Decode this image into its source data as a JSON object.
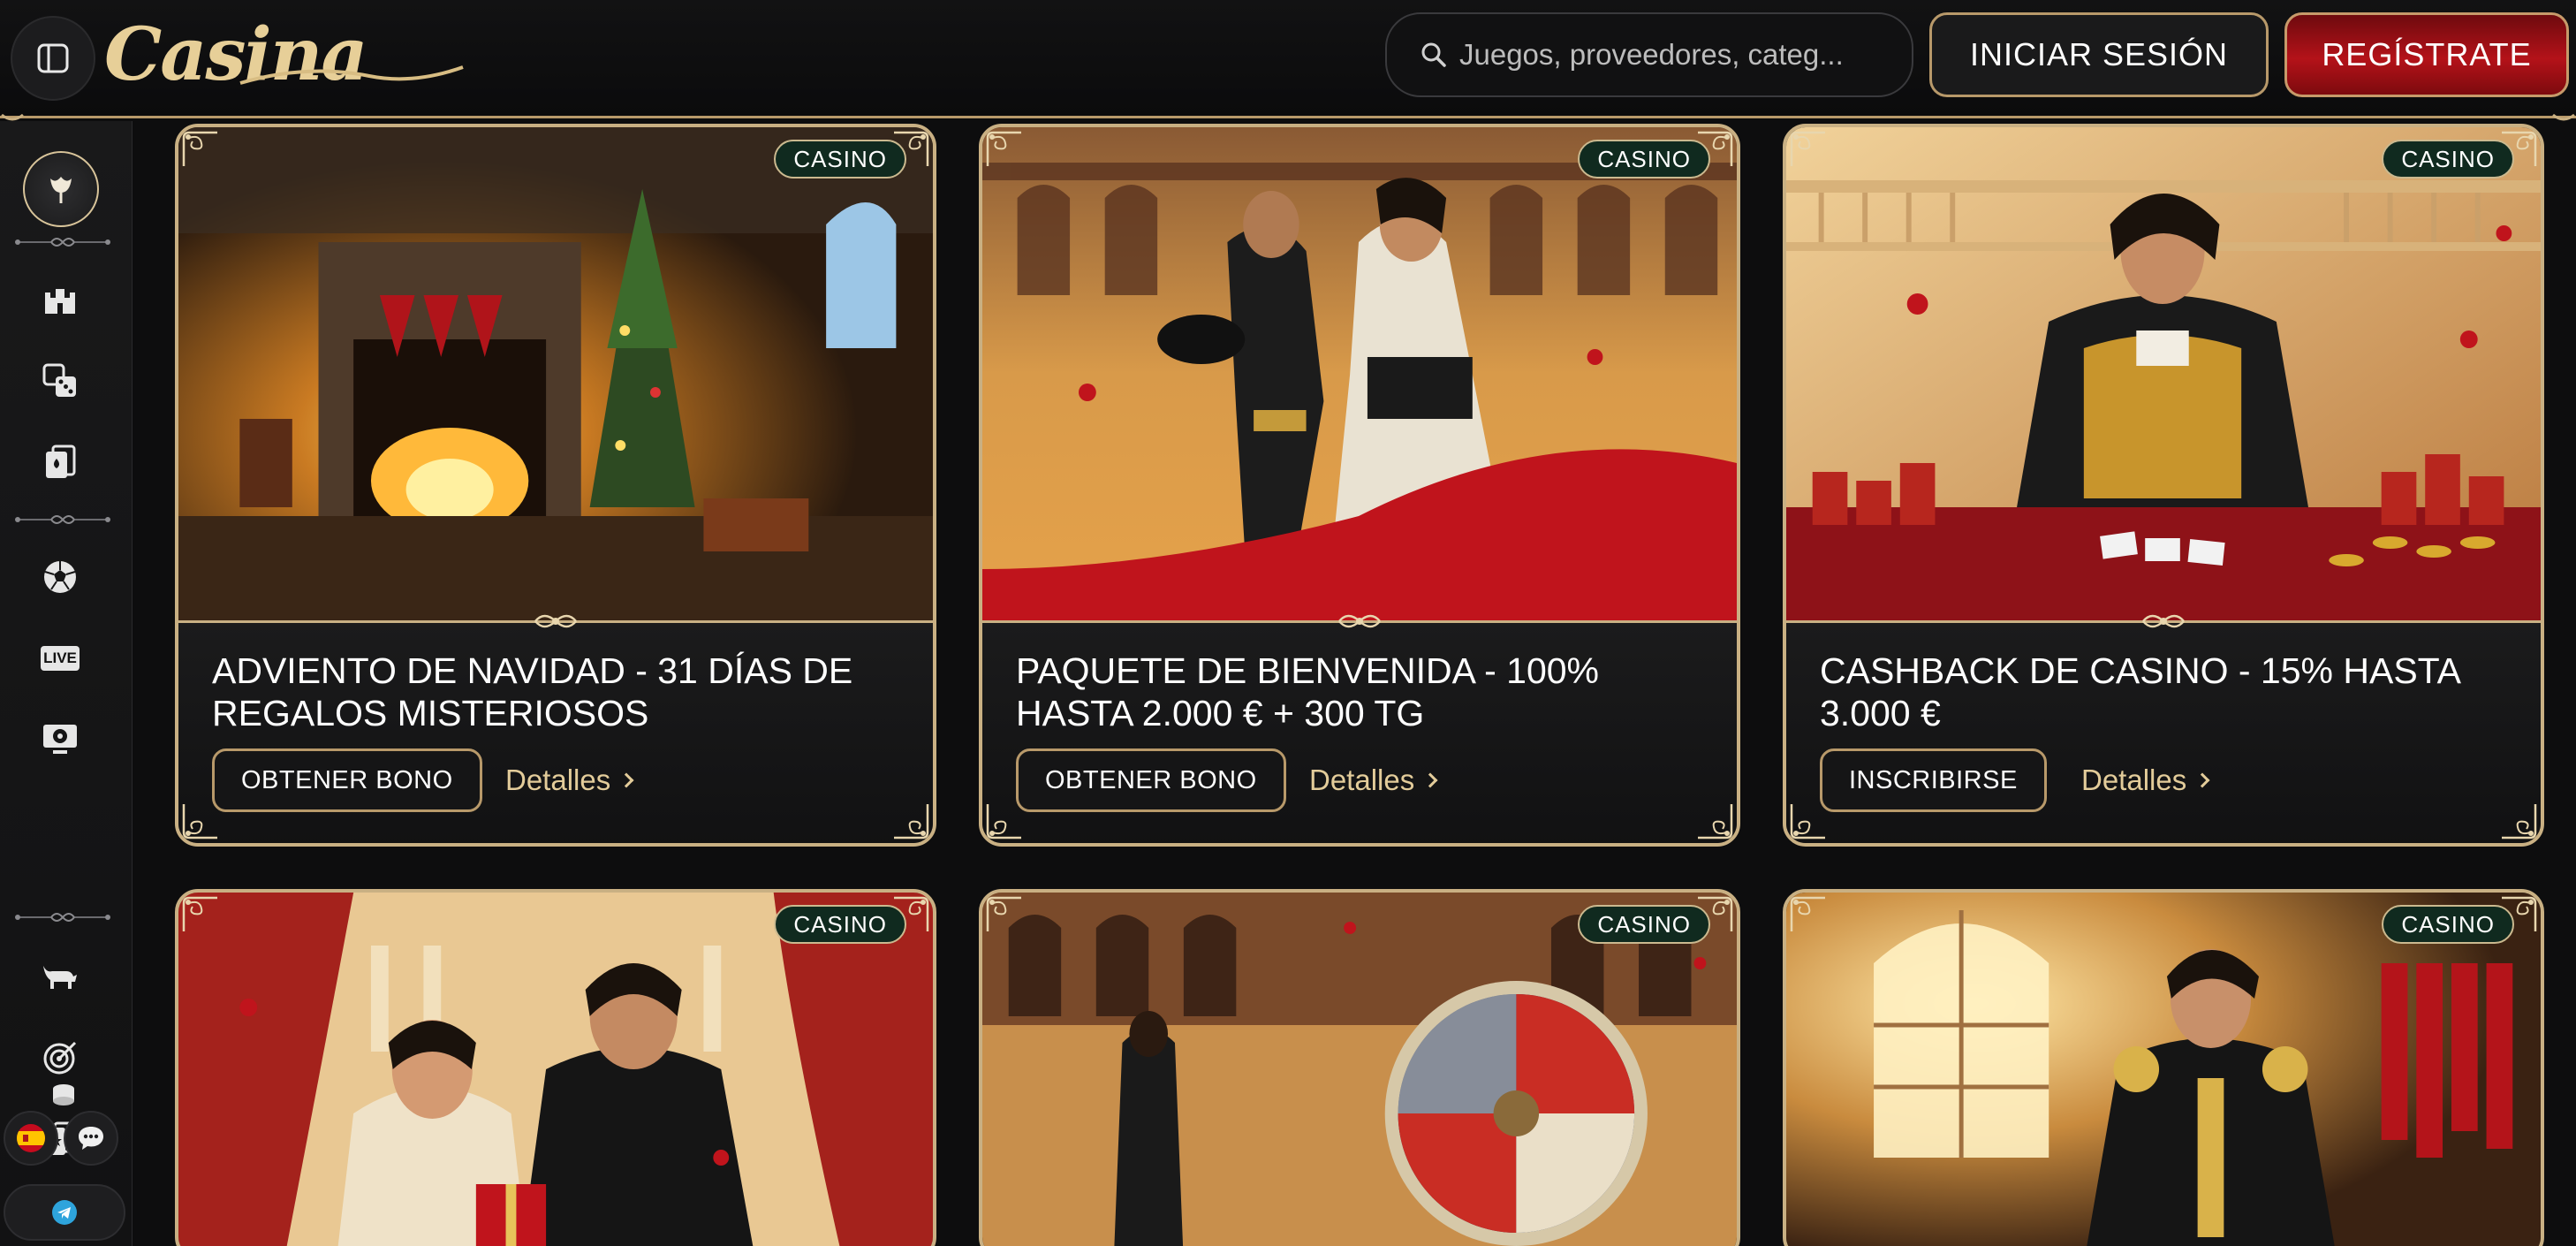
{
  "header": {
    "logo_text": "Casina",
    "search_placeholder": "Juegos, proveedores, categ...",
    "login_label": "INICIAR SESIÓN",
    "register_label": "REGÍSTRATE"
  },
  "sidebar": {
    "icons": [
      "home-tulip-icon",
      "castle-icon",
      "slots-dice-icon",
      "cards-icon",
      "soccer-ball-icon",
      "live-icon",
      "virtual-sports-icon",
      "bull-icon",
      "target-icon",
      "playing-card-star-icon",
      "coins-icon"
    ],
    "live_label": "LIVE",
    "language_icon": "spain-flag-icon",
    "chat_icon": "chat-icon",
    "telegram_icon": "telegram-icon"
  },
  "cards": [
    {
      "badge": "CASINO",
      "title": "ADVIENTO DE NAVIDAD - 31 DÍAS DE REGALOS MISTERIOSOS",
      "action": "OBTENER BONO",
      "details": "Detalles"
    },
    {
      "badge": "CASINO",
      "title": "PAQUETE DE BIENVENIDA - 100% HASTA 2.000 € + 300 TG",
      "action": "OBTENER BONO",
      "details": "Detalles"
    },
    {
      "badge": "CASINO",
      "title": "CASHBACK DE CASINO - 15% HASTA 3.000 €",
      "action": "INSCRIBIRSE",
      "details": "Detalles"
    },
    {
      "badge": "CASINO"
    },
    {
      "badge": "CASINO"
    },
    {
      "badge": "CASINO"
    }
  ],
  "colors": {
    "gold": "#c9b083",
    "register_red": "#b41219",
    "badge_green": "#102a1f",
    "background": "#0d0d0e"
  }
}
